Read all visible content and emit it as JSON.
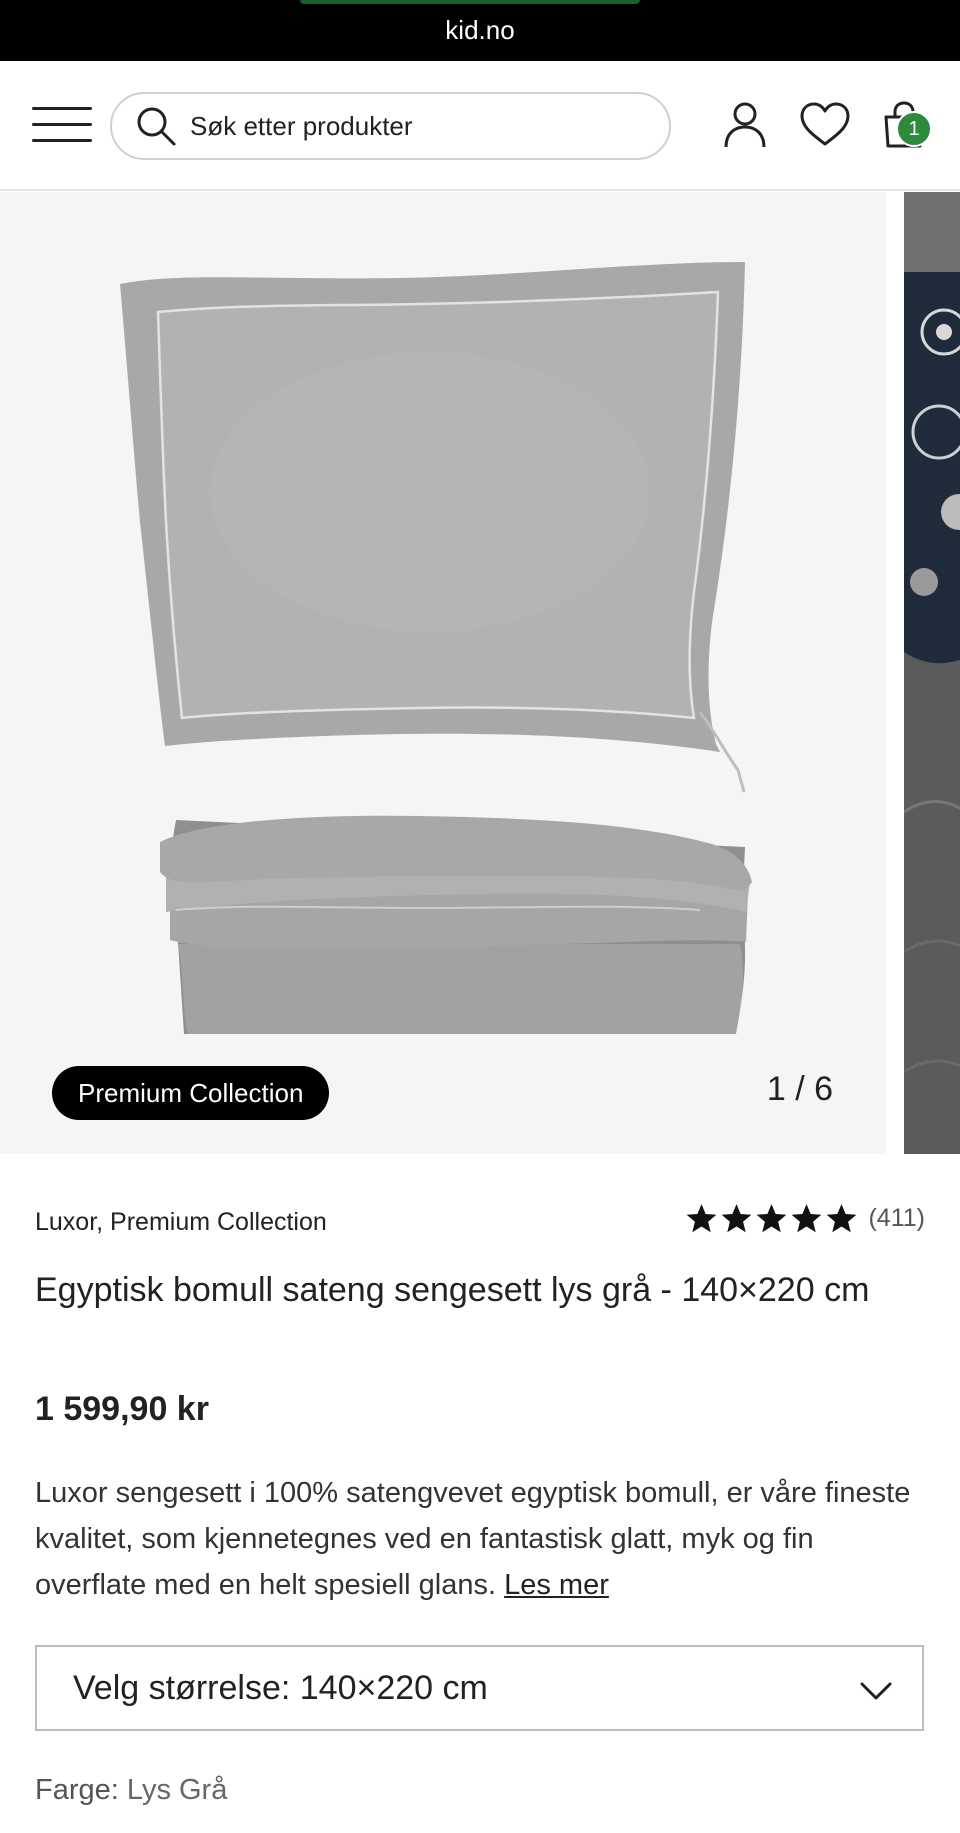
{
  "browser": {
    "url": "kid.no"
  },
  "header": {
    "search_placeholder": "Søk etter produkter",
    "cart_count": "1"
  },
  "gallery": {
    "badge": "Premium Collection",
    "counter": "1 / 6"
  },
  "product": {
    "brand": "Luxor, Premium Collection",
    "rating_stars": 5,
    "rating_count": "(411)",
    "title": "Egyptisk bomull sateng sengesett lys grå - 140×220 cm",
    "price": "1 599,90 kr",
    "description": "Luxor sengesett i 100% satengvevet egyptisk bomull, er våre fineste kvalitet, som kjennetegnes ved en fantastisk glatt, myk og fin overflate med en helt spesiell glans. ",
    "read_more": "Les mer",
    "size_select": "Velg størrelse: 140×220 cm",
    "color_label": "Farge:",
    "color_value": "Lys Grå"
  },
  "colors": {
    "accent_green": "#2e8b3e",
    "bedding_grey": "#9c9a9b"
  }
}
